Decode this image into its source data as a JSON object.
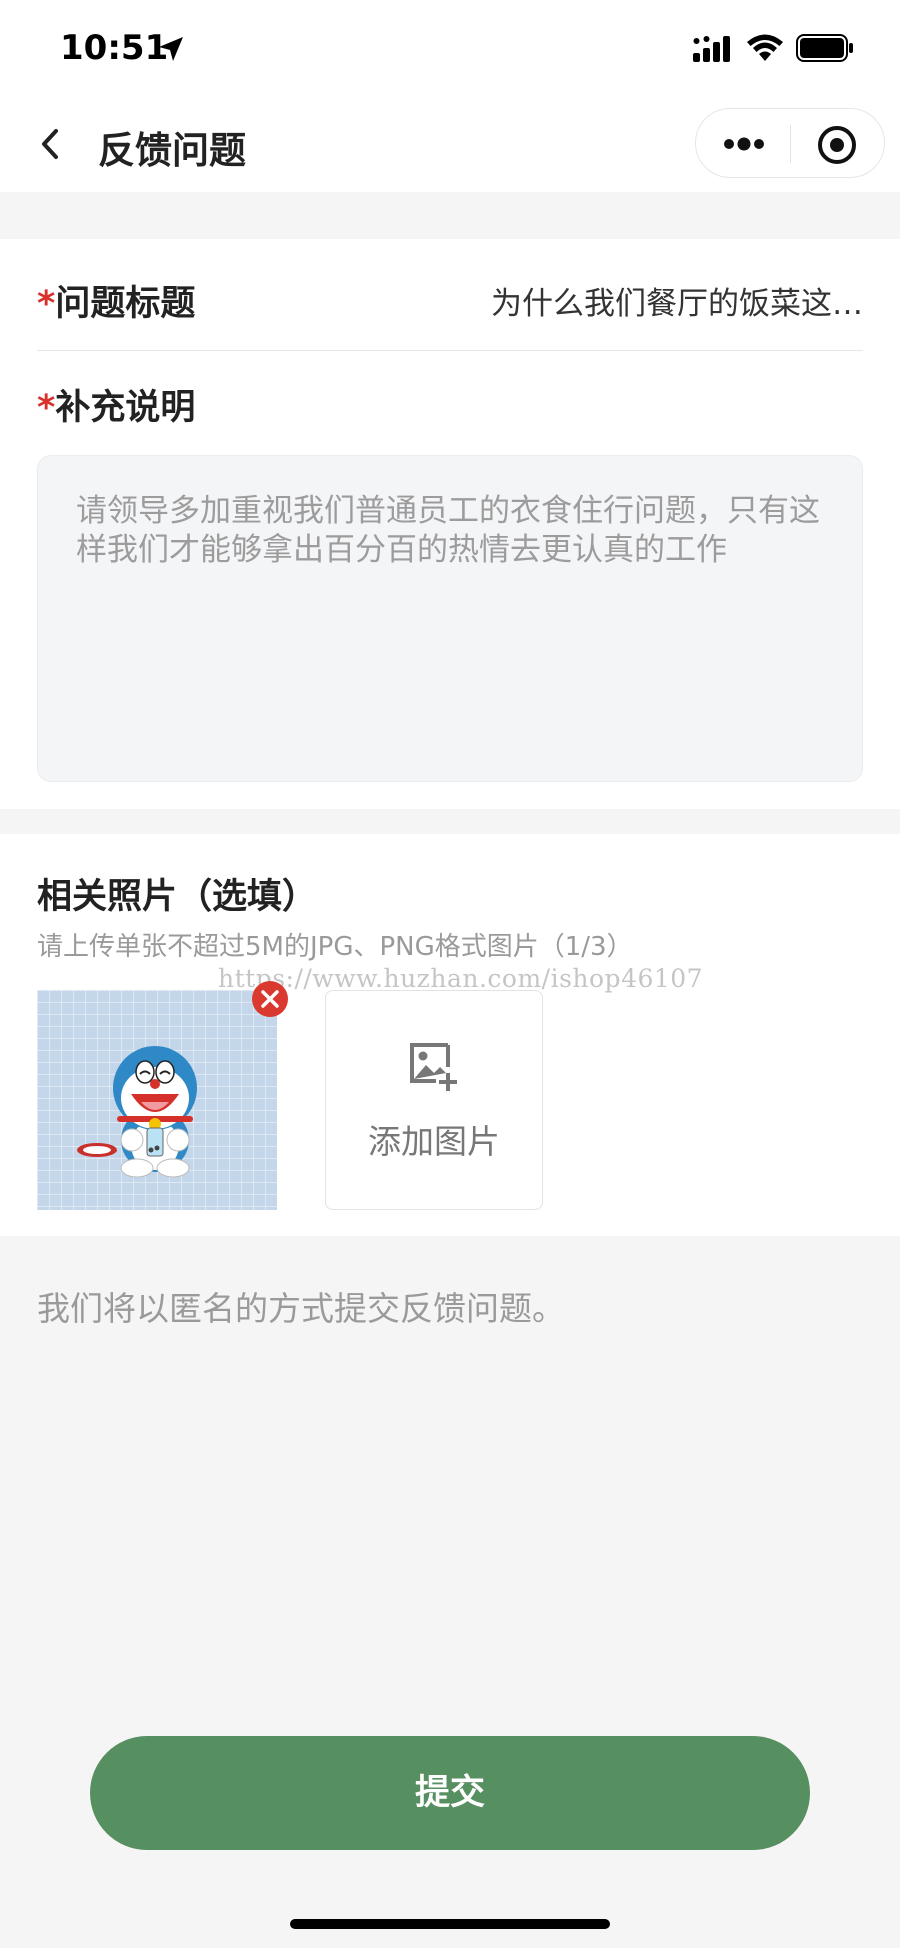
{
  "status_bar": {
    "time": "10:51",
    "icons": [
      "location-arrow-icon",
      "cellular-signal-icon",
      "wifi-icon",
      "battery-icon"
    ]
  },
  "nav": {
    "title": "反馈问题",
    "back_icon": "chevron-left-icon",
    "more_icon": "more-dots-icon",
    "close_icon": "target-circle-icon"
  },
  "form": {
    "required_mark": "*",
    "title_label": "问题标题",
    "title_value": "为什么我们餐厅的饭菜这…",
    "supplement_label": "补充说明",
    "supplement_text": "请领导多加重视我们普通员工的衣食住行问题，只有这样我们才能够拿出百分百的热情去更认真的工作"
  },
  "photos": {
    "title": "相关照片（选填）",
    "hint": "请上传单张不超过5M的JPG、PNG格式图片（1/3）",
    "watermark": "https://www.huzhan.com/ishop46107",
    "add_label": "添加图片",
    "thumbnail_icon": "doraemon-image",
    "remove_icon": "close-circle-icon",
    "add_icon": "add-image-icon"
  },
  "note": "我们将以匿名的方式提交反馈问题。",
  "submit_label": "提交",
  "colors": {
    "accent": "#568f60",
    "required": "#d9302c",
    "page_bg": "#f5f5f5",
    "remove_badge": "#d9392f"
  }
}
